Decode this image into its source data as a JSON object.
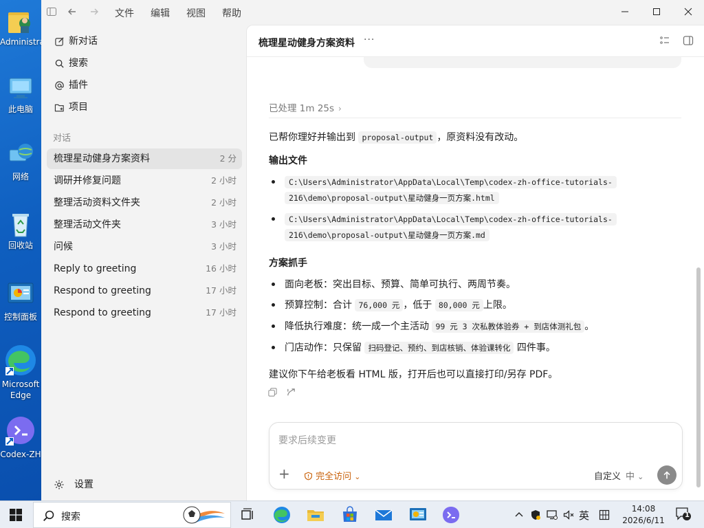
{
  "desktop": {
    "icons": [
      {
        "label": "Administrator"
      },
      {
        "label": "此电脑"
      },
      {
        "label": "网络"
      },
      {
        "label": "回收站"
      },
      {
        "label": "控制面板"
      },
      {
        "label": "Microsoft Edge"
      },
      {
        "label": "Codex-ZH"
      }
    ]
  },
  "menu": [
    "文件",
    "编辑",
    "视图",
    "帮助"
  ],
  "sidebar": {
    "nav": [
      {
        "label": "新对话",
        "icon": "edit-icon"
      },
      {
        "label": "搜索",
        "icon": "search-icon"
      },
      {
        "label": "插件",
        "icon": "at-icon"
      },
      {
        "label": "项目",
        "icon": "folder-plus-icon"
      }
    ],
    "section_label": "对话",
    "conversations": [
      {
        "title": "梳理星动健身方案资料",
        "time": "2 分"
      },
      {
        "title": "调研并修复问题",
        "time": "2 小时"
      },
      {
        "title": "整理活动资料文件夹",
        "time": "2 小时"
      },
      {
        "title": "整理活动文件夹",
        "time": "3 小时"
      },
      {
        "title": "问候",
        "time": "3 小时"
      },
      {
        "title": "Reply to greeting",
        "time": "16 小时"
      },
      {
        "title": "Respond to greeting",
        "time": "17 小时"
      },
      {
        "title": "Respond to greeting",
        "time": "17 小时"
      }
    ],
    "settings_label": "设置"
  },
  "main": {
    "title": "梳理星动健身方案资料",
    "more": "···",
    "processed": "已处理 1m 25s",
    "intro": {
      "before": "已帮你理好并输出到",
      "code": "proposal-output",
      "after": "，原资料没有改动。"
    },
    "output_heading": "输出文件",
    "files": [
      {
        "line1": "C:\\Users\\Administrator\\AppData\\Local\\Temp\\codex-zh-office-tutorials-",
        "line2": "216\\demo\\proposal-output\\星动健身一页方案.html"
      },
      {
        "line1": "C:\\Users\\Administrator\\AppData\\Local\\Temp\\codex-zh-office-tutorials-",
        "line2": "216\\demo\\proposal-output\\星动健身一页方案.md"
      }
    ],
    "plan_heading": "方案抓手",
    "points": {
      "p1": "面向老板：突出目标、预算、简单可执行、两周节奏。",
      "p2": {
        "a": "预算控制：合计",
        "c1": "76,000 元",
        "b": "，低于",
        "c2": "80,000 元",
        "d": "上限。"
      },
      "p3": {
        "a": "降低执行难度：统一成一个主活动",
        "c1": "99 元 3 次私教体验券 + 到店体测礼包",
        "b": "。"
      },
      "p4": {
        "a": "门店动作：只保留",
        "c1": "扫码登记、预约、到店核销、体验课转化",
        "b": "四件事。"
      }
    },
    "closing": "建议你下午给老板看 HTML 版，打开后也可以直接打印/另存 PDF。"
  },
  "composer": {
    "placeholder": "要求后续变更",
    "access_label": "完全访问",
    "custom_label": "自定义",
    "level_label": "中"
  },
  "taskbar": {
    "search_label": "搜索",
    "ime": "英",
    "time": "14:08",
    "date": "2026/6/11",
    "notifications": "1"
  },
  "colors": {
    "accent_orange": "#c9610a",
    "active_row": "#e4e4e4",
    "sidebar_bg": "#f3f3f3"
  }
}
